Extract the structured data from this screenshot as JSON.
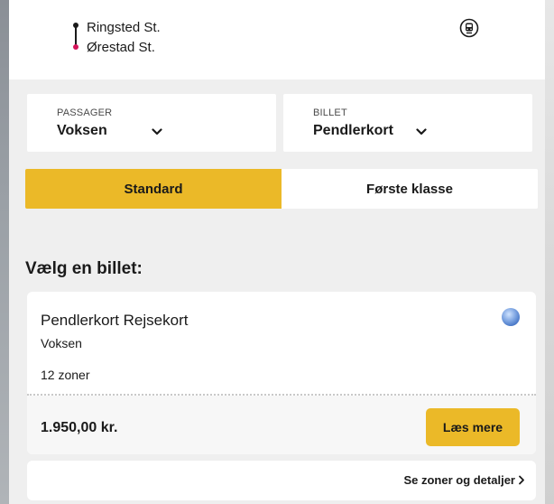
{
  "route": {
    "from": "Ringsted St.",
    "to": "Ørestad St.",
    "accent_color": "#d4145a",
    "transport_icon": "train-icon"
  },
  "passenger_select": {
    "label": "PASSAGER",
    "value": "Voksen"
  },
  "ticket_select": {
    "label": "BILLET",
    "value": "Pendlerkort"
  },
  "class_toggle": {
    "options": [
      "Standard",
      "Første klasse"
    ],
    "selected": "Standard",
    "active_color": "#ebb928"
  },
  "heading": "Vælg en billet:",
  "ticket": {
    "name": "Pendlerkort Rejsekort",
    "passenger": "Voksen",
    "zones": "12 zoner",
    "price": "1.950,00 kr.",
    "read_more_label": "Læs mere"
  },
  "details_link": "Se zoner og detaljer"
}
